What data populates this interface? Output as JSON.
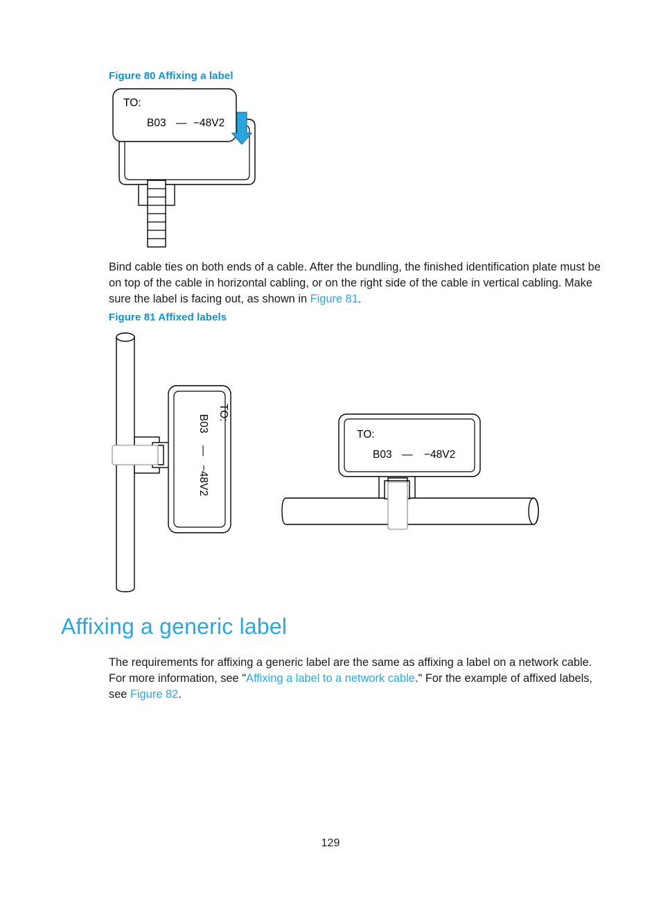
{
  "page": {
    "number": "129"
  },
  "figure80": {
    "caption": "Figure 80 Affixing a label",
    "label": {
      "line1": "TO:",
      "line2_left": "B03",
      "line2_dash": "—",
      "line2_right": "−48V2"
    },
    "arrow": {
      "name": "down-arrow",
      "color": "#2ba6dd",
      "direction": "down"
    }
  },
  "paragraph1": {
    "part1": "Bind cable ties on both ends of a cable. After the bundling, the finished identification plate must be on top of the cable in horizontal cabling, or on the right side of the cable in vertical cabling. Make sure the label is facing out, as shown in ",
    "link": "Figure 81",
    "part2": "."
  },
  "figure81": {
    "caption": "Figure 81 Affixed labels",
    "vertical": {
      "label": {
        "line1": "TO:",
        "line2_left": "B03",
        "line2_dash": "—",
        "line2_right": "−48V2"
      }
    },
    "horizontal": {
      "label": {
        "line1": "TO:",
        "line2_left": "B03",
        "line2_dash": "—",
        "line2_right": "−48V2"
      }
    }
  },
  "section": {
    "title": "Affixing a generic label"
  },
  "paragraph2": {
    "part1": "The requirements for affixing a generic label are the same as affixing a label on a network cable. For more information, see \"",
    "link1": "Affixing a label to a network cable",
    "part2": ".\" For the example of affixed labels, see ",
    "link2": "Figure 82",
    "part3": "."
  },
  "colors": {
    "heading": "#2ba6dd",
    "caption": "#1091ce",
    "link": "#2ba6dd",
    "text": "#1a1a1a"
  }
}
